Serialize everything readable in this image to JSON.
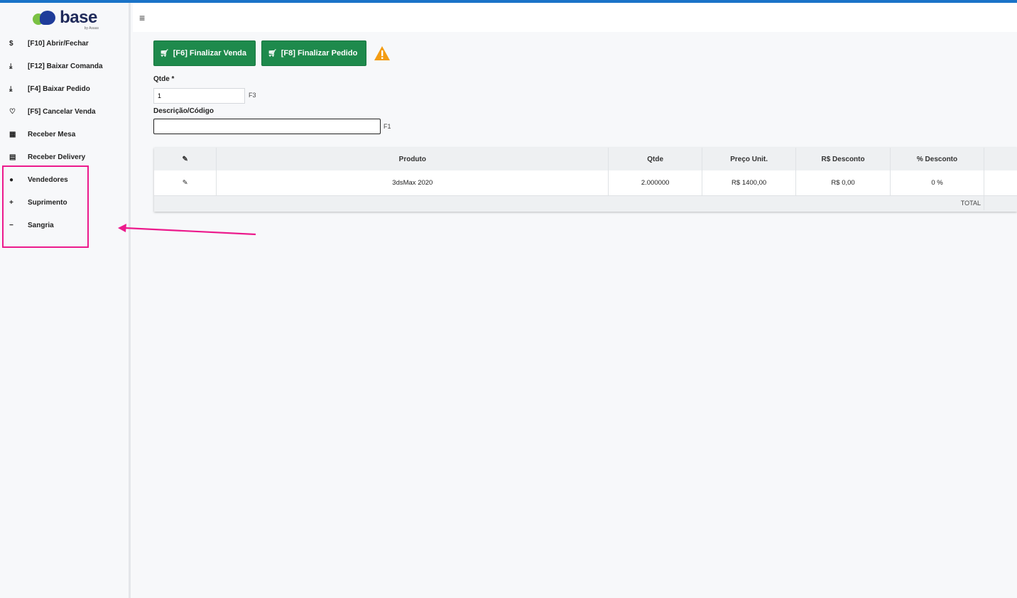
{
  "brand": {
    "name": "base",
    "byline": "by Asaas",
    "green": "#7ac143",
    "blue": "#1f3c9a"
  },
  "header": {
    "menu_icon": "hamburger-icon"
  },
  "sidebar": {
    "items": [
      {
        "icon": "dollar-icon",
        "glyph": "$",
        "label": "[F10] Abrir/Fechar"
      },
      {
        "icon": "download-icon",
        "glyph": "⤓",
        "label": "[F12] Baixar Comanda"
      },
      {
        "icon": "download-icon",
        "glyph": "⤓",
        "label": "[F4] Baixar Pedido"
      },
      {
        "icon": "thumbs-down-icon",
        "glyph": "♡",
        "label": "[F5] Cancelar Venda"
      },
      {
        "icon": "grid-icon",
        "glyph": "▦",
        "label": "Receber Mesa"
      },
      {
        "icon": "card-icon",
        "glyph": "▤",
        "label": "Receber Delivery"
      },
      {
        "icon": "users-icon",
        "glyph": "●",
        "label": "Vendedores"
      },
      {
        "icon": "plus-icon",
        "glyph": "+",
        "label": "Suprimento"
      },
      {
        "icon": "minus-icon",
        "glyph": "−",
        "label": "Sangria"
      }
    ]
  },
  "actions": {
    "finalizar_venda": "[F6] Finalizar Venda",
    "finalizar_pedido": "[F8] Finalizar Pedido",
    "color": "#1e8a4c",
    "warning_color": "#f39c12"
  },
  "form": {
    "qtde_label": "Qtde *",
    "qtde_value": "1",
    "qtde_hint": "F3",
    "desc_label": "Descrição/Código",
    "desc_value": "",
    "desc_hint": "F1"
  },
  "table": {
    "columns": [
      "Produto",
      "Qtde",
      "Preço Unit.",
      "R$ Desconto",
      "% Desconto"
    ],
    "rows": [
      {
        "produto": "3dsMax 2020",
        "qtde": "2.000000",
        "preco": "R$ 1400,00",
        "desconto_rs": "R$ 0,00",
        "desconto_pct": "0 %"
      }
    ],
    "total_label": "TOTAL"
  },
  "annotation": {
    "color": "#ec1a8c"
  }
}
